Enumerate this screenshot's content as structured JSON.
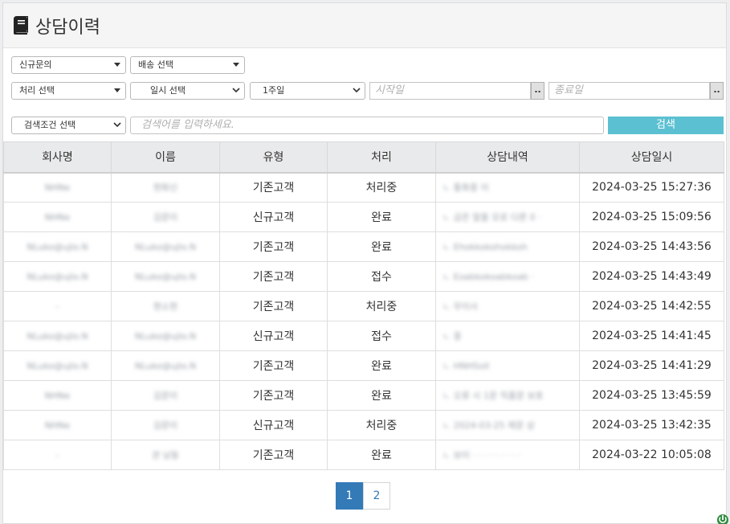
{
  "header": {
    "title": "상담이력",
    "icon": "book-icon"
  },
  "filters": {
    "inquiry": "신규문의",
    "delivery": "배송 선택",
    "process": "처리 선택",
    "datetime": "일시 선택",
    "period": "1주일",
    "start_placeholder": "시작일",
    "end_placeholder": "종료일",
    "date_btn": "..",
    "search_condition": "검색조건 선택",
    "search_placeholder": "검색어를 입력하세요.",
    "search_button": "검색"
  },
  "table": {
    "columns": [
      "회사명",
      "이름",
      "유형",
      "처리",
      "상담내역",
      "상담일시"
    ],
    "rows": [
      [
        "NHNe",
        "현화신",
        "기존고객",
        "처리중",
        "ㄴ 통화중 이",
        "2024-03-25 15:27:36"
      ],
      [
        "NHNe",
        "김문이",
        "신규고객",
        "완료",
        "ㄴ 금은 말을 모로 다른 0 ·",
        "2024-03-25 15:09:56"
      ],
      [
        "NLuko@ujlo.N",
        "NLuko@ujlo.N",
        "기존고객",
        "완료",
        "ㄴ Ehokkokohokkoh",
        "2024-03-25 14:43:56"
      ],
      [
        "NLuko@ujlo.N",
        "NLuko@ujlo.N",
        "기존고객",
        "접수",
        "ㄴ Eoabkokoabkoab ·",
        "2024-03-25 14:43:49"
      ],
      [
        "-",
        "현소현",
        "기존고객",
        "처리중",
        "ㄴ 무이사",
        "2024-03-25 14:42:55"
      ],
      [
        "NLuko@ujlo.N",
        "NLuko@ujlo.N",
        "신규고객",
        "접수",
        "ㄴ 중",
        "2024-03-25 14:41:45"
      ],
      [
        "NLuko@ujlo.N",
        "NLuko@ujlo.N",
        "기존고객",
        "완료",
        "ㄴ HNHSoll",
        "2024-03-25 14:41:29"
      ],
      [
        "NHNe",
        "김문이",
        "기존고객",
        "완료",
        "ㄴ 오류 시 1문 직품문 보호",
        "2024-03-25 13:45:59"
      ],
      [
        "NHNe",
        "김문이",
        "신규고객",
        "처리중",
        "ㄴ 2024-03-25 제문 상",
        "2024-03-25 13:42:35"
      ],
      [
        "-",
        "관 남동",
        "기존고객",
        "완료",
        "ㄴ 보이 · · · · · · · · ·",
        "2024-03-22 10:05:08"
      ]
    ]
  },
  "pagination": {
    "pages": [
      "1",
      "2"
    ],
    "active": "1"
  },
  "colors": {
    "accent": "#337ab7",
    "search_button": "#5bc0d1"
  }
}
